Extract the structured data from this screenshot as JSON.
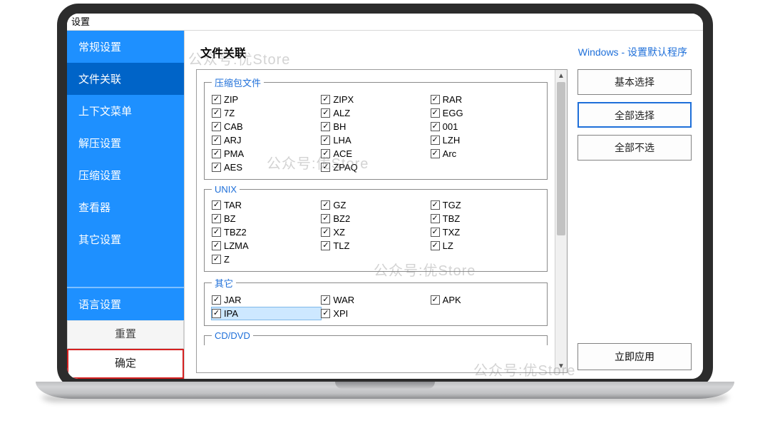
{
  "window": {
    "title": "设置"
  },
  "sidebar": {
    "items": [
      {
        "label": "常规设置"
      },
      {
        "label": "文件关联"
      },
      {
        "label": "上下文菜单"
      },
      {
        "label": "解压设置"
      },
      {
        "label": "压缩设置"
      },
      {
        "label": "查看器"
      },
      {
        "label": "其它设置"
      }
    ],
    "active_index": 1,
    "language_label": "语言设置",
    "reset_label": "重置",
    "ok_label": "确定"
  },
  "main": {
    "title": "文件关联",
    "windows_link": "Windows - 设置默认程序",
    "buttons": {
      "basic_select": "基本选择",
      "select_all": "全部选择",
      "select_none": "全部不选",
      "apply_now": "立即应用"
    },
    "groups": [
      {
        "legend": "压缩包文件",
        "columns": [
          [
            "ZIP",
            "7Z",
            "CAB",
            "ARJ",
            "PMA",
            "AES"
          ],
          [
            "ZIPX",
            "ALZ",
            "BH",
            "LHA",
            "ACE",
            "ZPAQ"
          ],
          [
            "RAR",
            "EGG",
            "001",
            "LZH",
            "Arc"
          ]
        ]
      },
      {
        "legend": "UNIX",
        "columns": [
          [
            "TAR",
            "BZ",
            "TBZ2",
            "LZMA",
            "Z"
          ],
          [
            "GZ",
            "BZ2",
            "XZ",
            "TLZ"
          ],
          [
            "TGZ",
            "TBZ",
            "TXZ",
            "LZ"
          ]
        ]
      },
      {
        "legend": "其它",
        "columns": [
          [
            "JAR",
            "IPA"
          ],
          [
            "WAR",
            "XPI"
          ],
          [
            "APK"
          ]
        ],
        "highlight": "IPA"
      },
      {
        "legend": "CD/DVD",
        "partial": true,
        "columns": []
      }
    ]
  },
  "watermark_text": "公众号:优Store"
}
